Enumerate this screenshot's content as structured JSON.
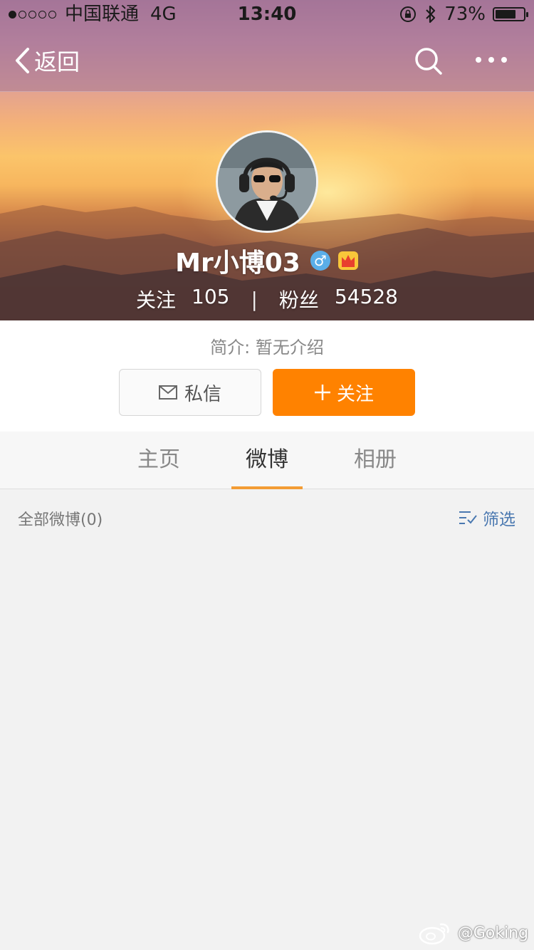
{
  "status_bar": {
    "carrier": "中国联通",
    "network": "4G",
    "time": "13:40",
    "battery_text": "73%",
    "battery_level": 0.73
  },
  "nav": {
    "back_label": "返回",
    "icons": [
      "search-icon",
      "more-icon"
    ]
  },
  "profile": {
    "name": "Mr小博03",
    "gender_symbol": "♂",
    "following_label": "关注",
    "following_count": "105",
    "divider": "|",
    "followers_label": "粉丝",
    "followers_count": "54528",
    "bio": "简介: 暂无介绍"
  },
  "actions": {
    "message_label": "私信",
    "follow_label": "关注"
  },
  "tabs": [
    {
      "label": "主页",
      "active": false
    },
    {
      "label": "微博",
      "active": true
    },
    {
      "label": "相册",
      "active": false
    }
  ],
  "list": {
    "all_posts_label": "全部微博(0)",
    "filter_label": "筛选"
  },
  "watermark": {
    "text": "@Goking"
  },
  "colors": {
    "accent_orange": "#ff8200",
    "tab_underline": "#f39c34",
    "link_blue": "#4a78b0",
    "gender_blue": "#5aaee8"
  }
}
